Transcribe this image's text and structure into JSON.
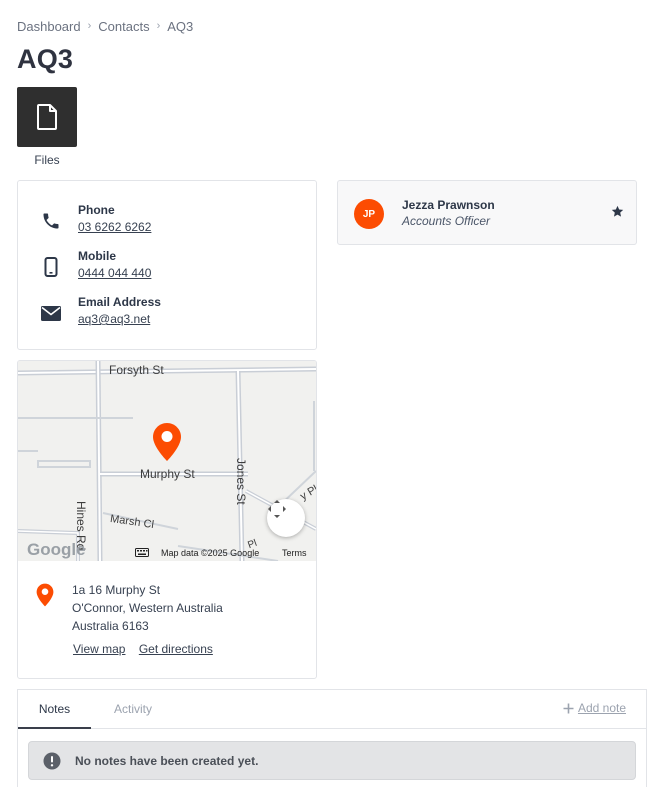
{
  "breadcrumb": [
    "Dashboard",
    "Contacts",
    "AQ3"
  ],
  "page_title": "AQ3",
  "files": {
    "label": "Files",
    "icon": "file-icon"
  },
  "contact": {
    "phone": {
      "label": "Phone",
      "value": "03 6262 6262",
      "icon": "phone-icon"
    },
    "mobile": {
      "label": "Mobile",
      "value": "0444 044 440",
      "icon": "mobile-icon"
    },
    "email": {
      "label": "Email Address",
      "value": "aq3@aq3.net",
      "icon": "envelope-icon"
    }
  },
  "map": {
    "streets": [
      "Forsyth St",
      "Murphy St",
      "Hines Rd",
      "Jones St",
      "Marsh Cl",
      "y Pl",
      "Pl"
    ],
    "logo": "Google",
    "attribution": "Map data ©2025 Google",
    "terms": "Terms",
    "pin_color": "#fc4c02"
  },
  "address": {
    "lines": [
      "1a 16 Murphy St",
      "O'Connor, Western Australia",
      "Australia 6163"
    ],
    "view_map": "View map",
    "get_directions": "Get directions"
  },
  "person": {
    "initials": "JP",
    "name": "Jezza Prawnson",
    "role": "Accounts Officer",
    "avatar_color": "#fc4c02"
  },
  "notes": {
    "tabs": [
      "Notes",
      "Activity"
    ],
    "add_note": "Add note",
    "empty_message": "No notes have been created yet."
  }
}
